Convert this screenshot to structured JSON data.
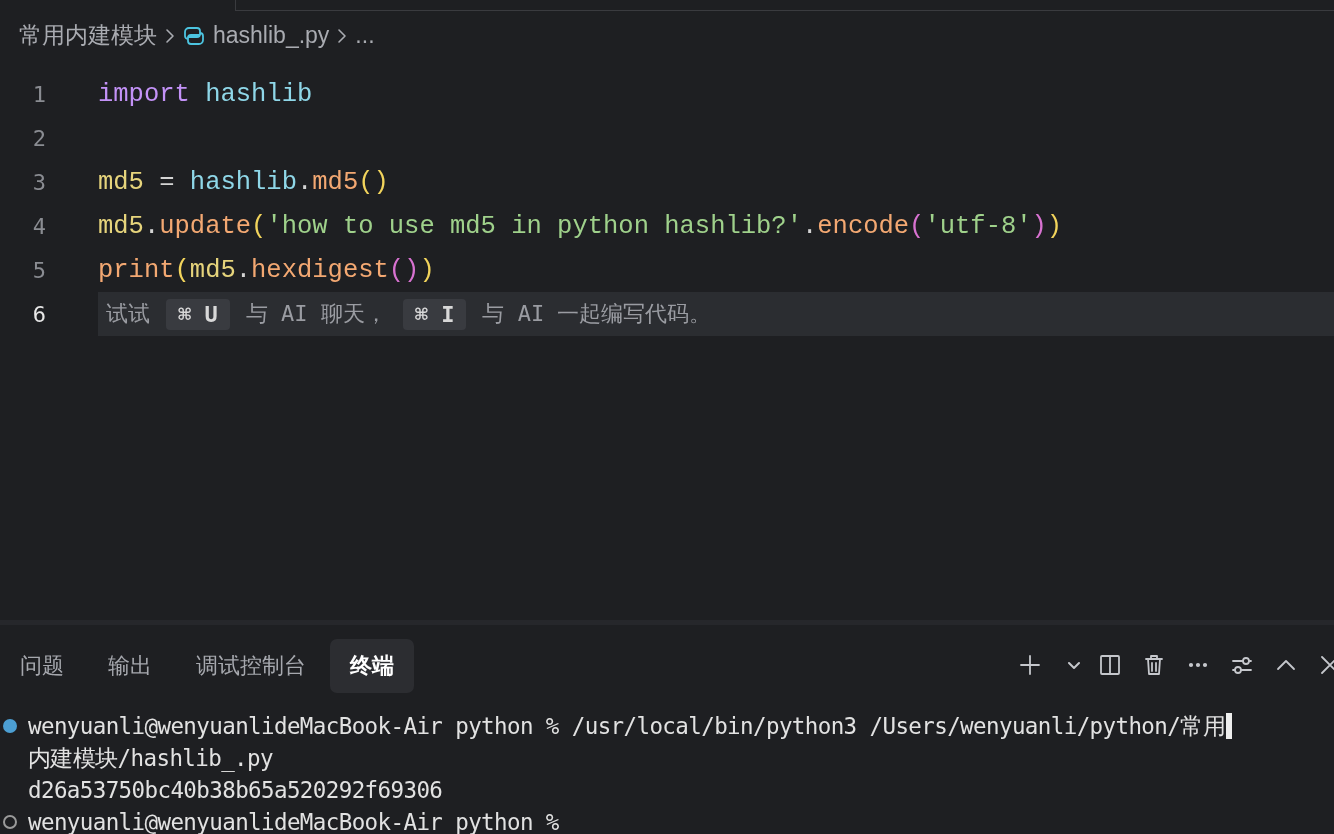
{
  "breadcrumb": {
    "folder": "常用内建模块",
    "file": "hashlib_.py",
    "more": "..."
  },
  "editor": {
    "lines": [
      {
        "number": "1",
        "current": false,
        "tokens": [
          {
            "kind": "keyword",
            "text": "import"
          },
          {
            "kind": "module",
            "text": " hashlib"
          }
        ]
      },
      {
        "number": "2",
        "current": false
      },
      {
        "number": "3",
        "current": false,
        "tokens": [
          {
            "kind": "variable",
            "text": "md5"
          },
          {
            "kind": "plain",
            "text": " = "
          },
          {
            "kind": "module",
            "text": "hashlib"
          },
          {
            "kind": "plain",
            "text": "."
          },
          {
            "kind": "function",
            "text": "md5"
          },
          {
            "kind": "paren",
            "text": "()"
          }
        ]
      },
      {
        "number": "4",
        "current": false,
        "tokens": [
          {
            "kind": "variable",
            "text": "md5"
          },
          {
            "kind": "plain",
            "text": "."
          },
          {
            "kind": "function",
            "text": "update"
          },
          {
            "kind": "paren",
            "text": "("
          },
          {
            "kind": "string",
            "text": "'how to use md5 in python hashlib?'"
          },
          {
            "kind": "plain",
            "text": "."
          },
          {
            "kind": "function",
            "text": "encode"
          },
          {
            "kind": "paren2",
            "text": "("
          },
          {
            "kind": "string",
            "text": "'utf-8'"
          },
          {
            "kind": "paren2",
            "text": ")"
          },
          {
            "kind": "paren",
            "text": ")"
          }
        ]
      },
      {
        "number": "5",
        "current": false,
        "tokens": [
          {
            "kind": "function",
            "text": "print"
          },
          {
            "kind": "paren",
            "text": "("
          },
          {
            "kind": "variable",
            "text": "md5"
          },
          {
            "kind": "plain",
            "text": "."
          },
          {
            "kind": "function",
            "text": "hexdigest"
          },
          {
            "kind": "paren2",
            "text": "()"
          },
          {
            "kind": "paren",
            "text": ")"
          }
        ]
      },
      {
        "number": "6",
        "current": true,
        "hint": [
          {
            "kind": "text",
            "text": "试试"
          },
          {
            "kind": "key",
            "text": "⌘ U"
          },
          {
            "kind": "text",
            "text": "与 AI 聊天，"
          },
          {
            "kind": "key",
            "text": "⌘ I"
          },
          {
            "kind": "text",
            "text": "与 AI 一起编写代码。"
          }
        ]
      }
    ]
  },
  "panel": {
    "tabs": [
      {
        "label": "问题",
        "selected": false
      },
      {
        "label": "输出",
        "selected": false
      },
      {
        "label": "调试控制台",
        "selected": false
      },
      {
        "label": "终端",
        "selected": true
      }
    ],
    "toolbar": [
      {
        "kind": "add"
      },
      {
        "kind": "dropdown"
      },
      {
        "kind": "split"
      },
      {
        "kind": "trash"
      },
      {
        "kind": "more"
      },
      {
        "kind": "sliders"
      },
      {
        "kind": "maximize"
      },
      {
        "kind": "close"
      }
    ]
  },
  "terminal": {
    "lines": [
      {
        "kind": "command",
        "completed": true,
        "text": "wenyuanli@wenyuanlideMacBook-Air python % /usr/local/bin/python3 /Users/wenyuanli/python/常用"
      },
      {
        "kind": "output",
        "text": "内建模块/hashlib_.py"
      },
      {
        "kind": "output",
        "text": "d26a53750bc40b38b65a520292f69306"
      },
      {
        "kind": "command",
        "completed": false,
        "text": "wenyuanli@wenyuanlideMacBook-Air python %"
      }
    ]
  }
}
